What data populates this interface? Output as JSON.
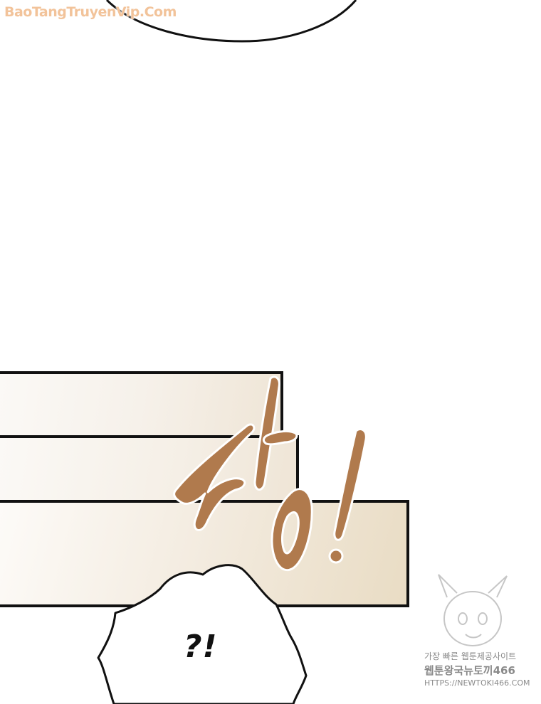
{
  "watermark": {
    "site": "BaoTangTruyenVip.Com"
  },
  "sfx": {
    "text": "캉!"
  },
  "dialogue": {
    "text": "?!"
  },
  "newtoki": {
    "line1": "가장 빠른 웹툰제공사이트",
    "line2": "웹툰왕국뉴토끼466",
    "line3": "HTTPS://NEWTOKI466.COM"
  },
  "colors": {
    "sfx_fill": "#b07a4d",
    "outline": "#111111",
    "watermark": "#f2c39a",
    "panel_gradient_end": "#e9dcc4"
  }
}
